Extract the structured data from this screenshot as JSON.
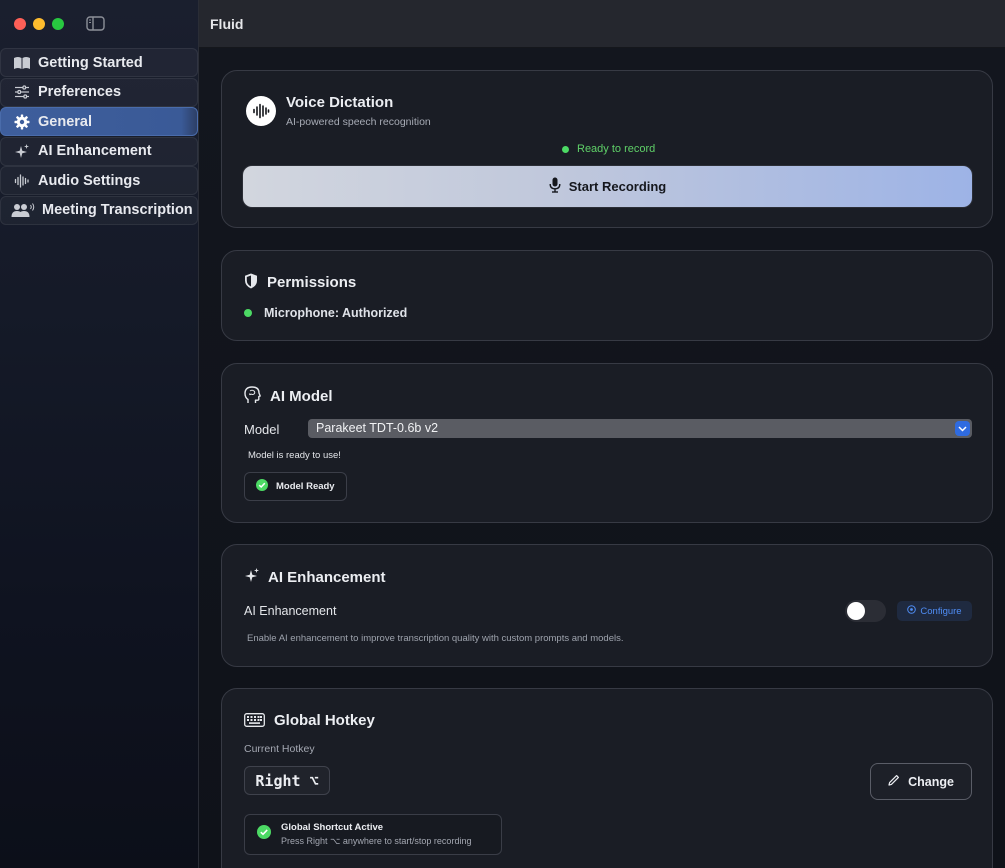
{
  "window": {
    "title": "Fluid",
    "controls": [
      "close",
      "minimize",
      "zoom"
    ]
  },
  "sidebar": {
    "toggle_icon": "sidebar-toggle-icon",
    "items": [
      {
        "label": "Getting Started",
        "icon": "book-icon",
        "active": false
      },
      {
        "label": "Preferences",
        "icon": "sliders-icon",
        "active": false
      },
      {
        "label": "General",
        "icon": "gear-icon",
        "active": true
      },
      {
        "label": "AI Enhancement",
        "icon": "sparkles-icon",
        "active": false
      },
      {
        "label": "Audio Settings",
        "icon": "waveform-icon",
        "active": false
      },
      {
        "label": "Meeting Transcription",
        "icon": "people-icon",
        "active": false
      }
    ]
  },
  "voice_dictation": {
    "title": "Voice Dictation",
    "subtitle": "AI-powered speech recognition",
    "status": "Ready to record",
    "button_label": "Start Recording"
  },
  "permissions": {
    "title": "Permissions",
    "microphone": "Microphone: Authorized"
  },
  "ai_model": {
    "title": "AI Model",
    "model_label": "Model",
    "selected_model": "Parakeet TDT-0.6b v2",
    "note": "Model is ready to use!",
    "status_badge": "Model Ready"
  },
  "ai_enhancement": {
    "title": "AI Enhancement",
    "toggle_label": "AI Enhancement",
    "enabled": false,
    "configure_label": "Configure",
    "description": "Enable AI enhancement to improve transcription quality with custom prompts and models."
  },
  "global_hotkey": {
    "title": "Global Hotkey",
    "current_label": "Current Hotkey",
    "hotkey": "Right ⌥",
    "change_label": "Change",
    "shortcut_status": "Global Shortcut Active",
    "shortcut_hint": "Press Right ⌥ anywhere to start/stop recording"
  },
  "colors": {
    "accent": "#3e5e9c",
    "status_green": "#4cd964",
    "link_blue": "#4f8df5"
  }
}
